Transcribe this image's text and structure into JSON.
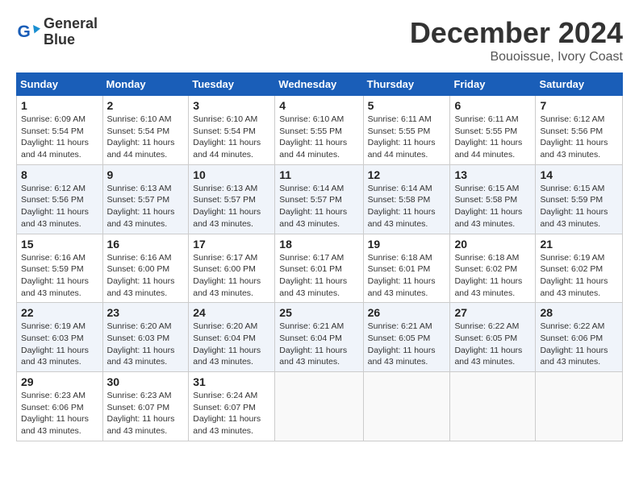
{
  "header": {
    "logo_line1": "General",
    "logo_line2": "Blue",
    "month": "December 2024",
    "location": "Bouoissue, Ivory Coast"
  },
  "weekdays": [
    "Sunday",
    "Monday",
    "Tuesday",
    "Wednesday",
    "Thursday",
    "Friday",
    "Saturday"
  ],
  "weeks": [
    [
      {
        "day": "1",
        "sunrise": "6:09 AM",
        "sunset": "5:54 PM",
        "daylight": "11 hours and 44 minutes."
      },
      {
        "day": "2",
        "sunrise": "6:10 AM",
        "sunset": "5:54 PM",
        "daylight": "11 hours and 44 minutes."
      },
      {
        "day": "3",
        "sunrise": "6:10 AM",
        "sunset": "5:54 PM",
        "daylight": "11 hours and 44 minutes."
      },
      {
        "day": "4",
        "sunrise": "6:10 AM",
        "sunset": "5:55 PM",
        "daylight": "11 hours and 44 minutes."
      },
      {
        "day": "5",
        "sunrise": "6:11 AM",
        "sunset": "5:55 PM",
        "daylight": "11 hours and 44 minutes."
      },
      {
        "day": "6",
        "sunrise": "6:11 AM",
        "sunset": "5:55 PM",
        "daylight": "11 hours and 44 minutes."
      },
      {
        "day": "7",
        "sunrise": "6:12 AM",
        "sunset": "5:56 PM",
        "daylight": "11 hours and 43 minutes."
      }
    ],
    [
      {
        "day": "8",
        "sunrise": "6:12 AM",
        "sunset": "5:56 PM",
        "daylight": "11 hours and 43 minutes."
      },
      {
        "day": "9",
        "sunrise": "6:13 AM",
        "sunset": "5:57 PM",
        "daylight": "11 hours and 43 minutes."
      },
      {
        "day": "10",
        "sunrise": "6:13 AM",
        "sunset": "5:57 PM",
        "daylight": "11 hours and 43 minutes."
      },
      {
        "day": "11",
        "sunrise": "6:14 AM",
        "sunset": "5:57 PM",
        "daylight": "11 hours and 43 minutes."
      },
      {
        "day": "12",
        "sunrise": "6:14 AM",
        "sunset": "5:58 PM",
        "daylight": "11 hours and 43 minutes."
      },
      {
        "day": "13",
        "sunrise": "6:15 AM",
        "sunset": "5:58 PM",
        "daylight": "11 hours and 43 minutes."
      },
      {
        "day": "14",
        "sunrise": "6:15 AM",
        "sunset": "5:59 PM",
        "daylight": "11 hours and 43 minutes."
      }
    ],
    [
      {
        "day": "15",
        "sunrise": "6:16 AM",
        "sunset": "5:59 PM",
        "daylight": "11 hours and 43 minutes."
      },
      {
        "day": "16",
        "sunrise": "6:16 AM",
        "sunset": "6:00 PM",
        "daylight": "11 hours and 43 minutes."
      },
      {
        "day": "17",
        "sunrise": "6:17 AM",
        "sunset": "6:00 PM",
        "daylight": "11 hours and 43 minutes."
      },
      {
        "day": "18",
        "sunrise": "6:17 AM",
        "sunset": "6:01 PM",
        "daylight": "11 hours and 43 minutes."
      },
      {
        "day": "19",
        "sunrise": "6:18 AM",
        "sunset": "6:01 PM",
        "daylight": "11 hours and 43 minutes."
      },
      {
        "day": "20",
        "sunrise": "6:18 AM",
        "sunset": "6:02 PM",
        "daylight": "11 hours and 43 minutes."
      },
      {
        "day": "21",
        "sunrise": "6:19 AM",
        "sunset": "6:02 PM",
        "daylight": "11 hours and 43 minutes."
      }
    ],
    [
      {
        "day": "22",
        "sunrise": "6:19 AM",
        "sunset": "6:03 PM",
        "daylight": "11 hours and 43 minutes."
      },
      {
        "day": "23",
        "sunrise": "6:20 AM",
        "sunset": "6:03 PM",
        "daylight": "11 hours and 43 minutes."
      },
      {
        "day": "24",
        "sunrise": "6:20 AM",
        "sunset": "6:04 PM",
        "daylight": "11 hours and 43 minutes."
      },
      {
        "day": "25",
        "sunrise": "6:21 AM",
        "sunset": "6:04 PM",
        "daylight": "11 hours and 43 minutes."
      },
      {
        "day": "26",
        "sunrise": "6:21 AM",
        "sunset": "6:05 PM",
        "daylight": "11 hours and 43 minutes."
      },
      {
        "day": "27",
        "sunrise": "6:22 AM",
        "sunset": "6:05 PM",
        "daylight": "11 hours and 43 minutes."
      },
      {
        "day": "28",
        "sunrise": "6:22 AM",
        "sunset": "6:06 PM",
        "daylight": "11 hours and 43 minutes."
      }
    ],
    [
      {
        "day": "29",
        "sunrise": "6:23 AM",
        "sunset": "6:06 PM",
        "daylight": "11 hours and 43 minutes."
      },
      {
        "day": "30",
        "sunrise": "6:23 AM",
        "sunset": "6:07 PM",
        "daylight": "11 hours and 43 minutes."
      },
      {
        "day": "31",
        "sunrise": "6:24 AM",
        "sunset": "6:07 PM",
        "daylight": "11 hours and 43 minutes."
      },
      null,
      null,
      null,
      null
    ]
  ]
}
